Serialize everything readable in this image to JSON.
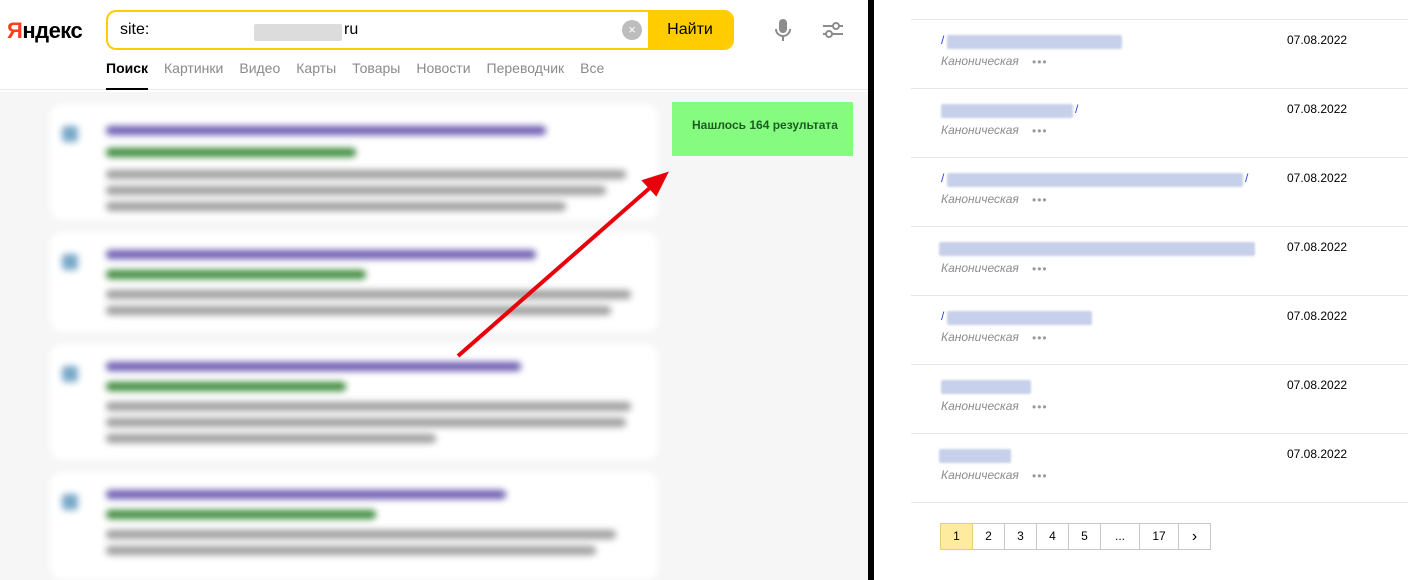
{
  "logo": {
    "first": "Я",
    "rest": "ндекс"
  },
  "search": {
    "query_prefix": "site:",
    "query_suffix": "ru",
    "clear_glyph": "×",
    "find_label": "Найти"
  },
  "tabs": [
    {
      "label": "Поиск",
      "active": true
    },
    {
      "label": "Картинки"
    },
    {
      "label": "Видео"
    },
    {
      "label": "Карты"
    },
    {
      "label": "Товары"
    },
    {
      "label": "Новости"
    },
    {
      "label": "Переводчик"
    },
    {
      "label": "Все"
    }
  ],
  "found_badge": "Нашлось 164 результата",
  "colors": {
    "accent_yellow": "#ffcc00",
    "badge_green": "#85fb80",
    "arrow_red": "#e8000b",
    "link_blue": "#1a3dc1",
    "pager_active": "#ffeba0"
  },
  "pages_list": {
    "rows": [
      {
        "url_prefix": "/",
        "url_suffix": "",
        "type": "Каноническая",
        "more": "•••",
        "date": "07.08.2022"
      },
      {
        "url_prefix": "",
        "url_suffix": "/",
        "type": "Каноническая",
        "more": "•••",
        "date": "07.08.2022"
      },
      {
        "url_prefix": "/",
        "url_suffix": "/",
        "type": "Каноническая",
        "more": "•••",
        "date": "07.08.2022"
      },
      {
        "url_prefix": "",
        "url_suffix": "",
        "type": "Каноническая",
        "more": "•••",
        "date": "07.08.2022"
      },
      {
        "url_prefix": "/",
        "url_suffix": "",
        "type": "Каноническая",
        "more": "•••",
        "date": "07.08.2022"
      },
      {
        "url_prefix": "",
        "url_suffix": "",
        "type": "Каноническая",
        "more": "•••",
        "date": "07.08.2022"
      },
      {
        "url_prefix": "",
        "url_suffix": "",
        "type": "Каноническая",
        "more": "•••",
        "date": "07.08.2022"
      }
    ]
  },
  "pagination": {
    "pages": [
      "1",
      "2",
      "3",
      "4",
      "5",
      "...",
      "17"
    ],
    "active": "1",
    "next_glyph": "›"
  }
}
